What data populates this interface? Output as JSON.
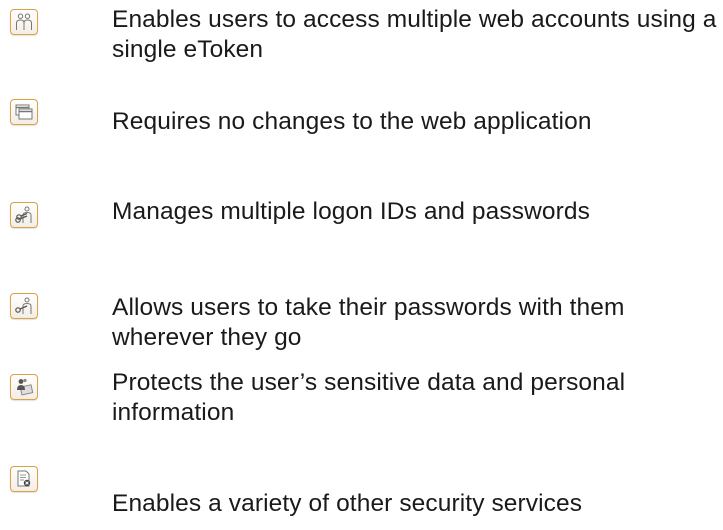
{
  "features": [
    {
      "icon": "users-icon",
      "text": "Enables users to access multiple web accounts using a single eToken"
    },
    {
      "icon": "windows-icon",
      "text": "Requires no changes to the web application"
    },
    {
      "icon": "keys-icon",
      "text": "Manages multiple logon IDs and passwords"
    },
    {
      "icon": "key-user-icon",
      "text": "Allows users to take their passwords with them wherever they go"
    },
    {
      "icon": "protected-user-icon",
      "text": "Protects the user’s sensitive data and personal information"
    },
    {
      "icon": "secure-document-icon",
      "text": "Enables a variety of other security services"
    }
  ],
  "colors": {
    "icon_border": "#d9a248",
    "icon_glyph": "#6b6b6b",
    "text": "#1a1a1a"
  }
}
